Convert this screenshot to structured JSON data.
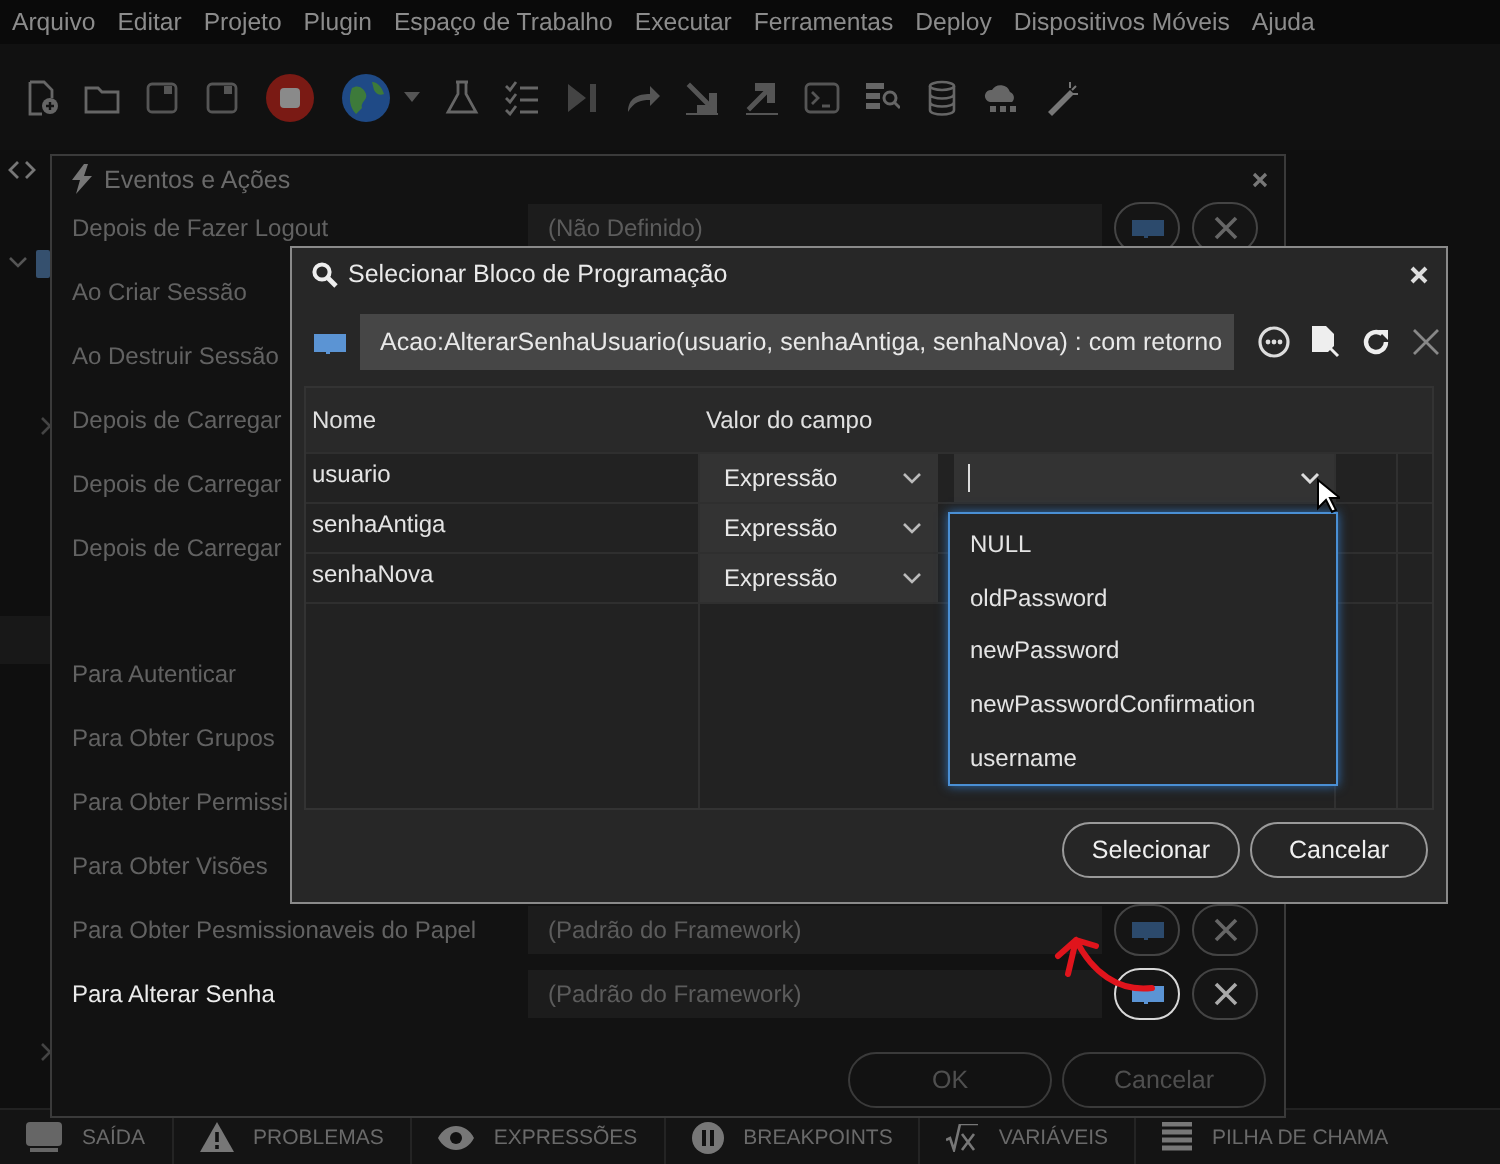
{
  "menu_bar": [
    "Arquivo",
    "Editar",
    "Projeto",
    "Plugin",
    "Espaço de Trabalho",
    "Executar",
    "Ferramentas",
    "Deploy",
    "Dispositivos Móveis",
    "Ajuda"
  ],
  "events_dialog": {
    "title": "Eventos e Ações",
    "groups": [
      {
        "rows": [
          {
            "label": "Depois de Fazer Logout",
            "value": "(Não Definido)",
            "selected": false
          },
          {
            "label": "Ao Criar Sessão",
            "selected": false
          },
          {
            "label": "Ao Destruir Sessão",
            "selected": false
          },
          {
            "label": "Depois de Carregar",
            "selected": false
          },
          {
            "label": "Depois de Carregar",
            "selected": false
          },
          {
            "label": "Depois de Carregar",
            "selected": false
          }
        ]
      },
      {
        "rows": [
          {
            "label": "Para Autenticar",
            "selected": false
          },
          {
            "label": "Para Obter Grupos",
            "selected": false
          },
          {
            "label": "Para Obter Permissi",
            "selected": false
          },
          {
            "label": "Para Obter Visões",
            "selected": false
          },
          {
            "label": "Para Obter Pesmissionaveis do Papel",
            "value": "(Padrão do Framework)",
            "selected": false
          },
          {
            "label": "Para Alterar Senha",
            "value": "(Padrão do Framework)",
            "selected": true
          }
        ]
      }
    ],
    "buttons": [
      "OK",
      "Cancelar"
    ]
  },
  "block_dialog": {
    "title": "Selecionar Bloco de Programação",
    "signature": "Acao:AlterarSenhaUsuario(usuario, senhaAntiga, senhaNova) : com retorno",
    "columns": [
      "Nome",
      "Valor do campo"
    ],
    "params": [
      {
        "name": "usuario",
        "type": "Expressão",
        "expanded": true
      },
      {
        "name": "senhaAntiga",
        "type": "Expressão",
        "expanded": false
      },
      {
        "name": "senhaNova",
        "type": "Expressão",
        "expanded": false
      }
    ],
    "dropdown_options": [
      "NULL",
      "oldPassword",
      "newPassword",
      "newPasswordConfirmation",
      "username"
    ],
    "buttons": [
      "Selecionar",
      "Cancelar"
    ]
  },
  "bottom_tabs": [
    {
      "label": "SAÍDA",
      "kind": "output"
    },
    {
      "label": "PROBLEMAS",
      "kind": "problems"
    },
    {
      "label": "EXPRESSÕES",
      "kind": "watch"
    },
    {
      "label": "BREAKPOINTS",
      "kind": "breakpoints"
    },
    {
      "label": "VARIÁVEIS",
      "kind": "variables"
    },
    {
      "label": "PILHA DE CHAMA",
      "kind": "stack"
    }
  ]
}
